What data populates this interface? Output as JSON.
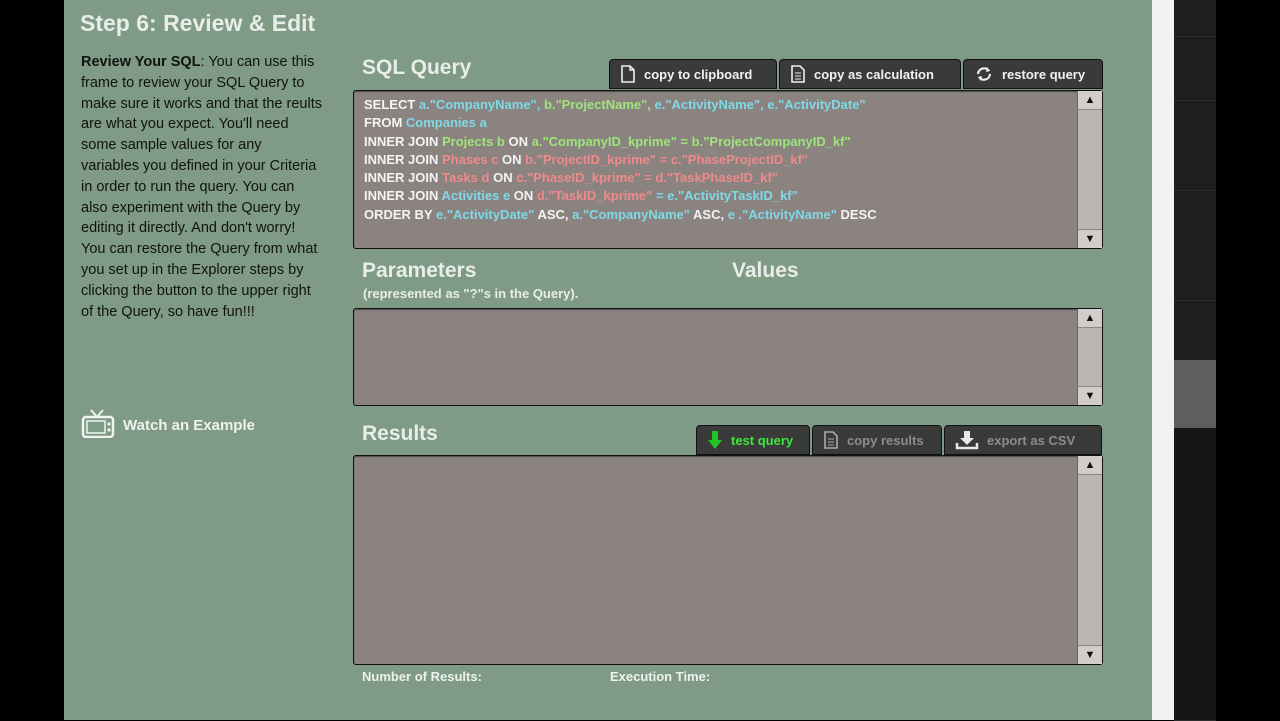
{
  "step_title": "Step 6: Review & Edit",
  "help": {
    "heading": "Review Your SQL",
    "body": ":  You can use this frame to review your SQL Query to make sure it works and that the reults are what you expect.  You'll need some sample values for any variables you defined in your Criteria in order to run the query.  You can also experiment with the Query by editing it directly.  And don't worry! You can restore the Query from what you set up in the Explorer steps by clicking the button to the upper right of the Query, so have fun!!!"
  },
  "watch_example": {
    "label": "Watch an Example",
    "icon": "tv-icon"
  },
  "sql_section": {
    "title": "SQL Query",
    "buttons": [
      {
        "label": "copy to clipboard",
        "icon": "document-icon"
      },
      {
        "label": "copy as calculation",
        "icon": "document-lines-icon"
      },
      {
        "label": "restore query",
        "icon": "refresh-icon"
      }
    ],
    "lines": [
      [
        [
          "kw",
          "SELECT "
        ],
        [
          "c1",
          "a.\"CompanyName\", "
        ],
        [
          "c2",
          "b.\"ProjectName\", "
        ],
        [
          "c1",
          "e.\"ActivityName\", e.\"ActivityDate\""
        ]
      ],
      [
        [
          "kw",
          "FROM "
        ],
        [
          "c1",
          "Companies a"
        ]
      ],
      [
        [
          "kw",
          "INNER JOIN "
        ],
        [
          "c2",
          "Projects b "
        ],
        [
          "kw",
          "ON "
        ],
        [
          "c2",
          "a.\"CompanyID_kprime\" = b.\"ProjectCompanyID_kf\""
        ]
      ],
      [
        [
          "kw",
          "INNER JOIN "
        ],
        [
          "c3",
          "Phases c "
        ],
        [
          "kw",
          "ON "
        ],
        [
          "c3",
          "b.\"ProjectID_kprime\" = c.\"PhaseProjectID_kf\""
        ]
      ],
      [
        [
          "kw",
          "INNER JOIN "
        ],
        [
          "c3",
          "Tasks d "
        ],
        [
          "kw",
          "ON "
        ],
        [
          "c3",
          "c.\"PhaseID_kprime\" = d.\"TaskPhaseID_kf\""
        ]
      ],
      [
        [
          "kw",
          "INNER JOIN "
        ],
        [
          "c1",
          "Activities e "
        ],
        [
          "kw",
          "ON "
        ],
        [
          "c3",
          "d.\"TaskID_kprime\" "
        ],
        [
          "c1",
          "= e.\"ActivityTaskID_kf\""
        ]
      ],
      [
        [
          "kw",
          "ORDER BY "
        ],
        [
          "c1",
          "e.\"ActivityDate\" "
        ],
        [
          "kw",
          "ASC, "
        ],
        [
          "c1",
          "a.\"CompanyName\" "
        ],
        [
          "kw",
          "ASC, "
        ],
        [
          "c1",
          "e .\"ActivityName\" "
        ],
        [
          "kw",
          "DESC"
        ]
      ]
    ]
  },
  "parameters": {
    "title": "Parameters",
    "note": "(represented as \"?\"s in the Query).",
    "values_title": "Values"
  },
  "results": {
    "title": "Results",
    "buttons": [
      {
        "label": "test query",
        "icon": "down-arrow-icon",
        "state": "active"
      },
      {
        "label": "copy results",
        "icon": "document-lines-icon",
        "state": "dim"
      },
      {
        "label": "export as CSV",
        "icon": "download-icon",
        "state": "dim"
      }
    ],
    "number_label": "Number of Results:",
    "time_label": "Execution Time:"
  },
  "colors": {
    "background": "#7f9a85",
    "panel": "#8a8380",
    "keyword": "#f4f4f4",
    "blue_field": "#7fd9e6",
    "green_field": "#9ee57a",
    "red_field": "#f08a8a",
    "test_query": "#3ce83c"
  }
}
